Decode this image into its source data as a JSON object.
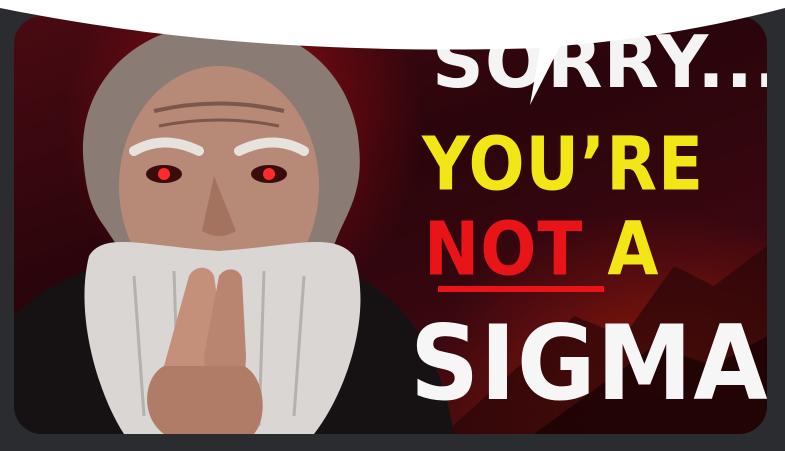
{
  "thumbnail": {
    "line1": "SORRY...",
    "line2": "YOU’RE",
    "line3_not": "NOT",
    "line3_a": "A",
    "line4": "SIGMA"
  },
  "colors": {
    "yellow": "#f2e616",
    "red": "#e81418",
    "white": "#f4f4f4",
    "background": "#2a2c2f"
  }
}
